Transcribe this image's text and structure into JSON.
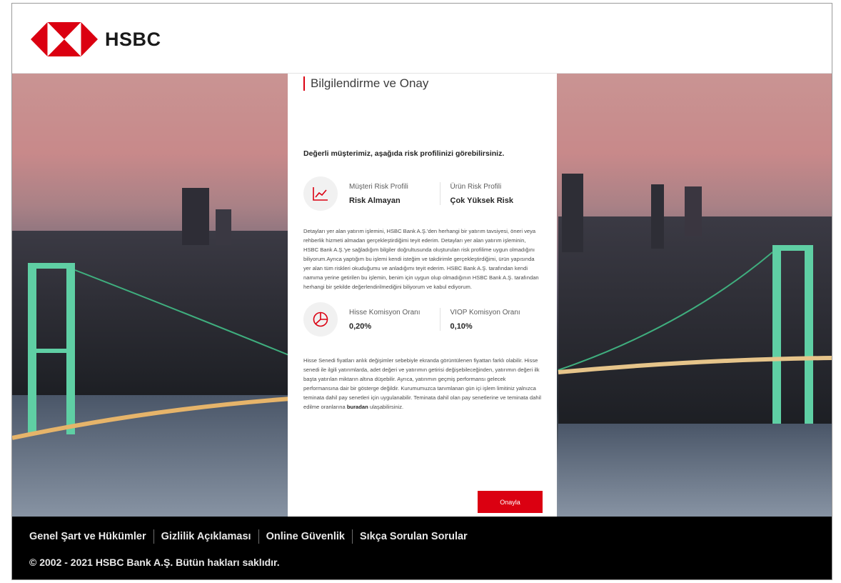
{
  "brand": {
    "name": "HSBC",
    "red": "#db0011"
  },
  "card": {
    "title": "Bilgilendirme ve Onay",
    "greeting": "Değerli müşterimiz, aşağıda risk profilinizi görebilirsiniz.",
    "risk": {
      "icon": "chart-line-icon",
      "customer_label": "Müşteri Risk Profili",
      "customer_value": "Risk Almayan",
      "product_label": "Ürün Risk Profili",
      "product_value": "Çok Yüksek Risk"
    },
    "paragraph1": "Detayları yer alan yatırım işlemini, HSBC Bank A.Ş.'den herhangi bir yatırım tavsiyesi, öneri veya rehberlik hizmeti almadan gerçekleştirdiğimi teyit ederim. Detayları yer alan yatırım işleminin, HSBC Bank A.Ş.'ye sağladığım bilgiler doğrultusunda oluşturulan risk profilime uygun olmadığını biliyorum.Ayrıca yaptığım bu işlemi kendi isteğim ve takdirimle gerçekleştirdiğimi, ürün yapısında yer alan tüm riskleri okuduğumu ve anladığımı teyit ederim. HSBC Bank A.Ş. tarafından kendi namıma yerine getirilen bu işlemin, benim için uygun olup olmadığının HSBC Bank A.Ş. tarafından herhangi bir şekilde değerlendirilmediğini biliyorum ve kabul ediyorum.",
    "commission": {
      "icon": "pie-chart-icon",
      "stock_label": "Hisse Komisyon Oranı",
      "stock_value": "0,20%",
      "viop_label": "VIOP Komisyon Oranı",
      "viop_value": "0,10%"
    },
    "paragraph2": "Hisse Senedi fiyatları anlık değişimler sebebiyle ekranda görüntülenen fiyattan farklı olabilir. Hisse senedi ile ilgili yatırımlarda, adet değeri ve yatırımın getirisi değişebileceğinden, yatırımın değeri ilk başta yatırılan miktarın altına düşebilir. Ayrıca, yatırımın geçmiş performansı gelecek performansına dair bir gösterge değildir. Kurumumuzca tanımlanan gün içi işlem limitiniz yalnızca teminata dahil pay senetleri için uygulanabilir. Teminata dahil olan pay senetlerine ve teminata dahil edilme oranlarına",
    "link_text": "buradan",
    "paragraph2_tail": " ulaşabilirsiniz.",
    "confirm_label": "Onayla"
  },
  "footer": {
    "links": [
      "Genel Şart ve Hükümler",
      "Gizlilik Açıklaması",
      "Online Güvenlik",
      "Sıkça Sorulan Sorular"
    ],
    "copyright": "© 2002 - 2021 HSBC Bank A.Ş. Bütün hakları saklıdır."
  }
}
